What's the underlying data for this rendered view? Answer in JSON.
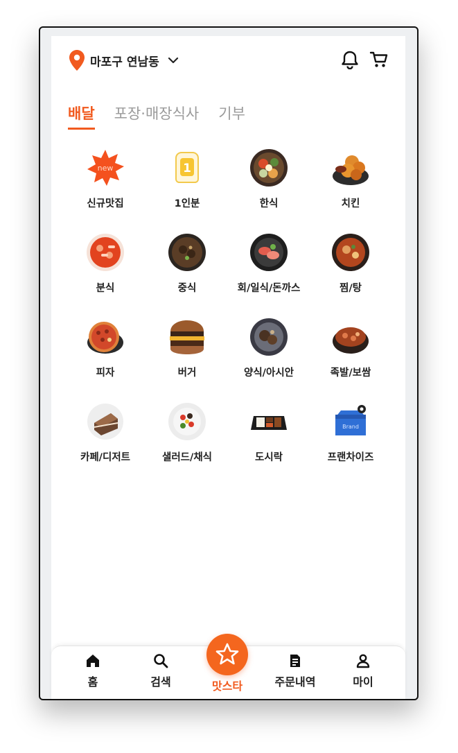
{
  "header": {
    "location": "마포구 연남동",
    "icons": [
      "location-pin-icon",
      "chevron-down-icon",
      "bell-icon",
      "cart-icon"
    ]
  },
  "tabs": [
    {
      "label": "배달",
      "active": true
    },
    {
      "label": "포장·매장식사",
      "active": false
    },
    {
      "label": "기부",
      "active": false
    }
  ],
  "categories": [
    {
      "label": "신규맛집",
      "icon": "new-badge-icon"
    },
    {
      "label": "1인분",
      "icon": "single-serving-icon"
    },
    {
      "label": "한식",
      "icon": "korean-food-icon"
    },
    {
      "label": "치킨",
      "icon": "chicken-icon"
    },
    {
      "label": "분식",
      "icon": "snack-food-icon"
    },
    {
      "label": "중식",
      "icon": "chinese-food-icon"
    },
    {
      "label": "회/일식/돈까스",
      "icon": "japanese-food-icon"
    },
    {
      "label": "찜/탕",
      "icon": "stew-icon"
    },
    {
      "label": "피자",
      "icon": "pizza-icon"
    },
    {
      "label": "버거",
      "icon": "burger-icon"
    },
    {
      "label": "양식/아시안",
      "icon": "western-food-icon"
    },
    {
      "label": "족발/보쌈",
      "icon": "pork-hock-icon"
    },
    {
      "label": "카페/디저트",
      "icon": "cake-icon"
    },
    {
      "label": "샐러드/채식",
      "icon": "salad-icon"
    },
    {
      "label": "도시락",
      "icon": "lunchbox-icon"
    },
    {
      "label": "프랜차이즈",
      "icon": "brand-store-icon"
    }
  ],
  "category_badges": {
    "new": "new",
    "one": "1",
    "brand": "Brand"
  },
  "bottom_nav": {
    "home": "홈",
    "search": "검색",
    "matsta": "맛스타",
    "orders": "주문내역",
    "my": "마이"
  },
  "colors": {
    "accent": "#f15a1f",
    "text": "#222222",
    "inactive_tab": "#9a9a9a"
  }
}
